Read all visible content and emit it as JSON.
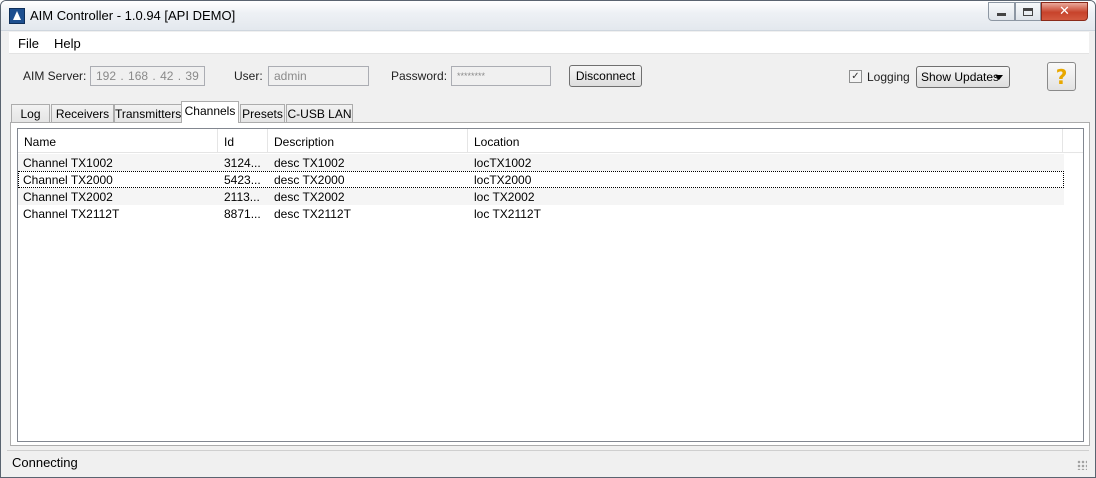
{
  "window": {
    "title": "AIM Controller - 1.0.94  [API DEMO]",
    "minimize_glyph": "minimize-icon",
    "maximize_glyph": "maximize-icon",
    "close_glyph": "✕"
  },
  "menu": {
    "file": "File",
    "help": "Help"
  },
  "connection": {
    "server_label": "AIM Server:",
    "ip": [
      "192",
      "168",
      "42",
      "39"
    ],
    "user_label": "User:",
    "user_value": "admin",
    "password_label": "Password:",
    "password_value": "********",
    "disconnect_label": "Disconnect",
    "logging_label": "Logging",
    "logging_checked": true,
    "show_updates_value": "Show Updates",
    "help_glyph": "?"
  },
  "tabs": [
    {
      "label": "Log"
    },
    {
      "label": "Receivers"
    },
    {
      "label": "Transmitters"
    },
    {
      "label": "Channels",
      "active": true
    },
    {
      "label": "Presets"
    },
    {
      "label": "C-USB LAN"
    }
  ],
  "channels": {
    "columns": [
      "Name",
      "Id",
      "Description",
      "Location"
    ],
    "rows": [
      {
        "name": "Channel TX1002",
        "id": "3124...",
        "description": "desc TX1002",
        "location": "locTX1002"
      },
      {
        "name": "Channel TX2000",
        "id": "5423...",
        "description": "desc TX2000",
        "location": "locTX2000"
      },
      {
        "name": "Channel TX2002",
        "id": "2113...",
        "description": "desc TX2002",
        "location": "loc TX2002"
      },
      {
        "name": "Channel TX2112T",
        "id": "8871...",
        "description": "desc TX2112T",
        "location": "loc TX2112T"
      }
    ]
  },
  "status": {
    "text": "Connecting"
  },
  "colors": {
    "close_button": "#c7432b",
    "help_icon": "#e8a800"
  }
}
